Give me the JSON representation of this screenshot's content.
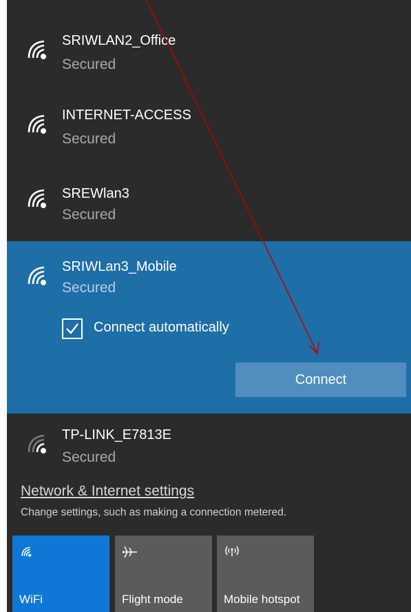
{
  "networks": [
    {
      "name": "SRIWLAN2_Office",
      "status": "Secured",
      "icon": "wifi-signal-icon"
    },
    {
      "name": "INTERNET-ACCESS",
      "status": "Secured",
      "icon": "wifi-signal-icon"
    },
    {
      "name": "SREWlan3",
      "status": "Secured",
      "icon": "wifi-signal-icon"
    },
    {
      "name": "SRIWLan3_Mobile",
      "status": "Secured",
      "icon": "wifi-signal-icon"
    },
    {
      "name": "TP-LINK_E7813E",
      "status": "Secured",
      "icon": "wifi-signal-weak-icon"
    }
  ],
  "selected": {
    "connect_auto_label": "Connect automatically",
    "connect_auto_checked": true,
    "connect_button": "Connect"
  },
  "footer": {
    "settings_link": "Network & Internet settings",
    "settings_desc": "Change settings, such as making a connection metered."
  },
  "quick_actions": [
    {
      "label": "WiFi",
      "icon": "wifi-icon",
      "active": true
    },
    {
      "label": "Flight mode",
      "icon": "airplane-icon",
      "active": false
    },
    {
      "label": "Mobile hotspot",
      "icon": "hotspot-icon",
      "active": false
    }
  ],
  "colors": {
    "panel_bg": "#2b2b2b",
    "selected_bg": "#1e6ea7",
    "accent": "#0f78d7",
    "annotation_arrow": "#c00000"
  }
}
